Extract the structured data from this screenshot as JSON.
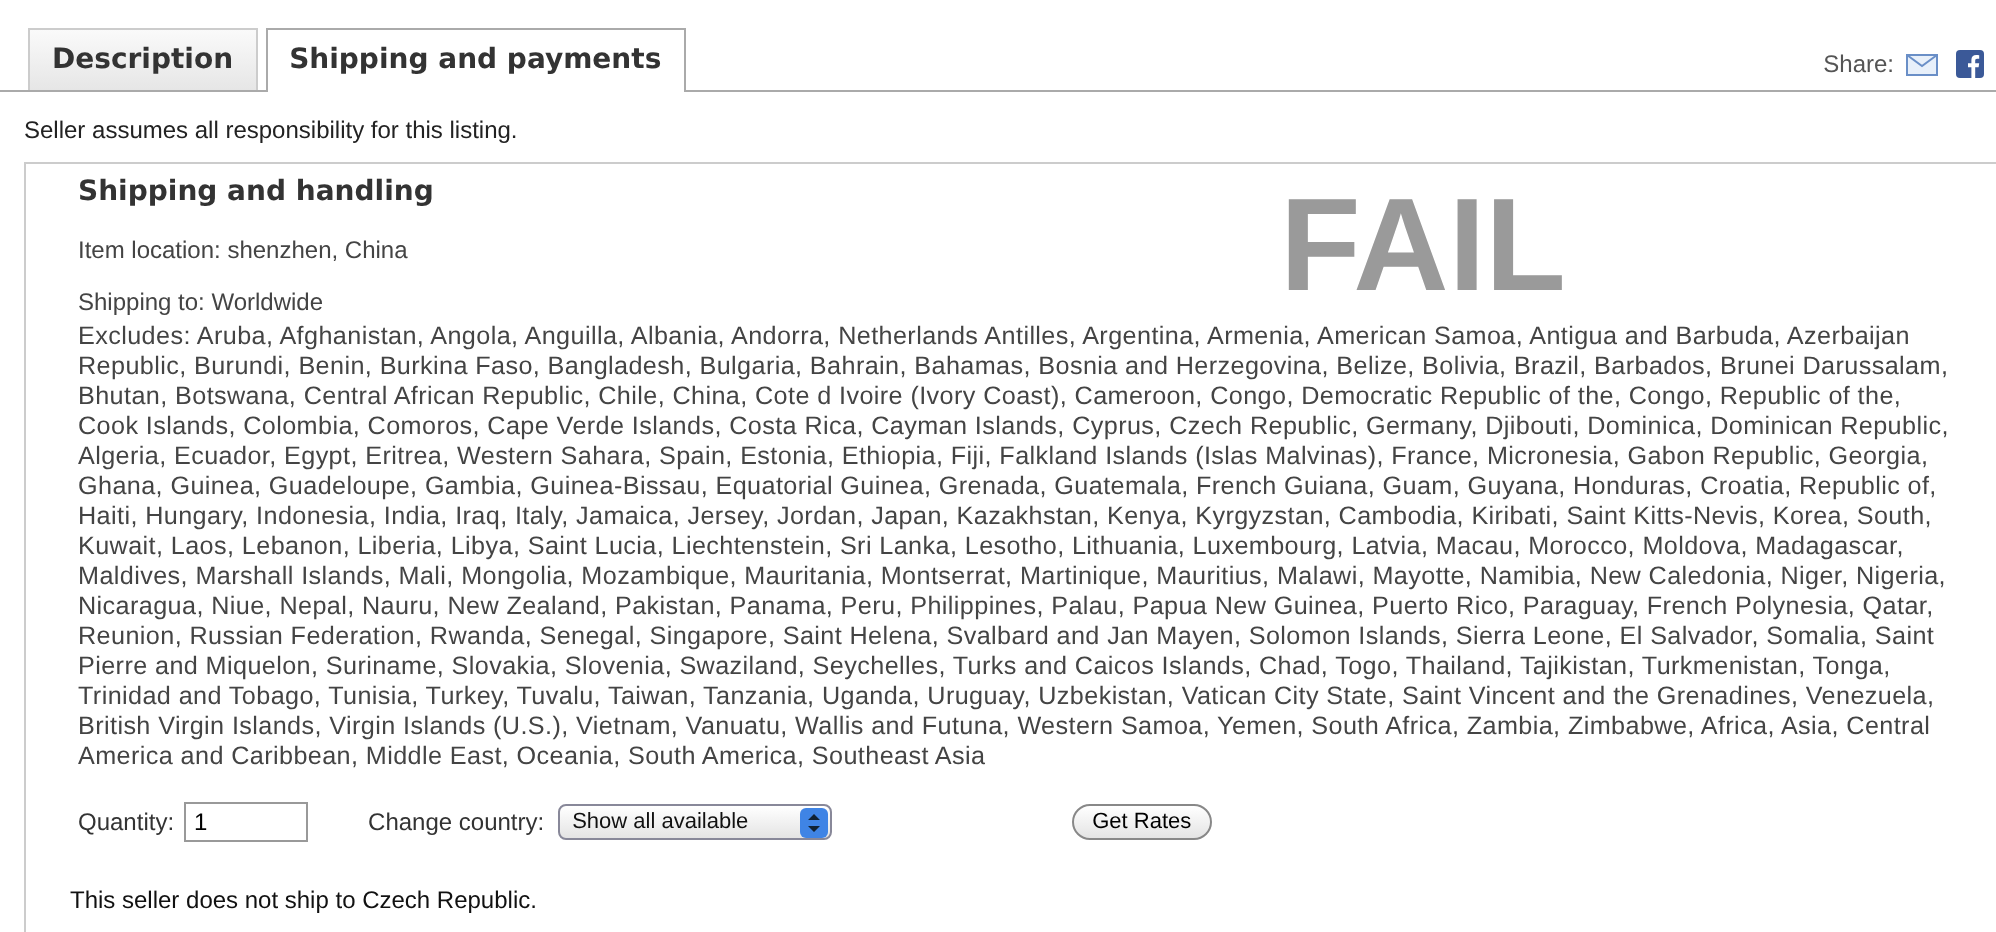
{
  "tabs": [
    {
      "label": "Description",
      "selected": false
    },
    {
      "label": "Shipping and payments",
      "selected": true
    }
  ],
  "share": {
    "label": "Share:"
  },
  "notice": "Seller assumes all responsibility for this listing.",
  "section": {
    "title": "Shipping and handling",
    "overlay": "FAIL",
    "item_location": "Item location: shenzhen, China",
    "shipping_to": "Shipping to: Worldwide",
    "excludes": "Excludes: Aruba, Afghanistan, Angola, Anguilla, Albania, Andorra, Netherlands Antilles, Argentina, Armenia, American Samoa, Antigua and Barbuda, Azerbaijan Republic, Burundi, Benin, Burkina Faso, Bangladesh, Bulgaria, Bahrain, Bahamas, Bosnia and Herzegovina, Belize, Bolivia, Brazil, Barbados, Brunei Darussalam, Bhutan, Botswana, Central African Republic, Chile, China, Cote d Ivoire (Ivory Coast), Cameroon, Congo, Democratic Republic of the, Congo, Republic of the, Cook Islands, Colombia, Comoros, Cape Verde Islands, Costa Rica, Cayman Islands, Cyprus, Czech Republic, Germany, Djibouti, Dominica, Dominican Republic, Algeria, Ecuador, Egypt, Eritrea, Western Sahara, Spain, Estonia, Ethiopia, Fiji, Falkland Islands (Islas Malvinas), France, Micronesia, Gabon Republic, Georgia, Ghana, Guinea, Guadeloupe, Gambia, Guinea-Bissau, Equatorial Guinea, Grenada, Guatemala, French Guiana, Guam, Guyana, Honduras, Croatia, Republic of, Haiti, Hungary, Indonesia, India, Iraq, Italy, Jamaica, Jersey, Jordan, Japan, Kazakhstan, Kenya, Kyrgyzstan, Cambodia, Kiribati, Saint Kitts-Nevis, Korea, South, Kuwait, Laos, Lebanon, Liberia, Libya, Saint Lucia, Liechtenstein, Sri Lanka, Lesotho, Lithuania, Luxembourg, Latvia, Macau, Morocco, Moldova, Madagascar, Maldives, Marshall Islands, Mali, Mongolia, Mozambique, Mauritania, Montserrat, Martinique, Mauritius, Malawi, Mayotte, Namibia, New Caledonia, Niger, Nigeria, Nicaragua, Niue, Nepal, Nauru, New Zealand, Pakistan, Panama, Peru, Philippines, Palau, Papua New Guinea, Puerto Rico, Paraguay, French Polynesia, Qatar, Reunion, Russian Federation, Rwanda, Senegal, Singapore, Saint Helena, Svalbard and Jan Mayen, Solomon Islands, Sierra Leone, El Salvador, Somalia, Saint Pierre and Miquelon, Suriname, Slovakia, Slovenia, Swaziland, Seychelles, Turks and Caicos Islands, Chad, Togo, Thailand, Tajikistan, Turkmenistan, Tonga, Trinidad and Tobago, Tunisia, Turkey, Tuvalu, Taiwan, Tanzania, Uganda, Uruguay, Uzbekistan, Vatican City State, Saint Vincent and the Grenadines, Venezuela, British Virgin Islands, Virgin Islands (U.S.), Vietnam, Vanuatu, Wallis and Futuna, Western Samoa, Yemen, South Africa, Zambia, Zimbabwe, Africa, Asia, Central America and Caribbean, Middle East, Oceania, South America, Southeast Asia",
    "quantity": {
      "label": "Quantity:",
      "value": "1"
    },
    "country": {
      "label": "Change country:",
      "value": "Show all available"
    },
    "get_rates": "Get Rates",
    "message": "This seller does not ship to Czech Republic."
  }
}
